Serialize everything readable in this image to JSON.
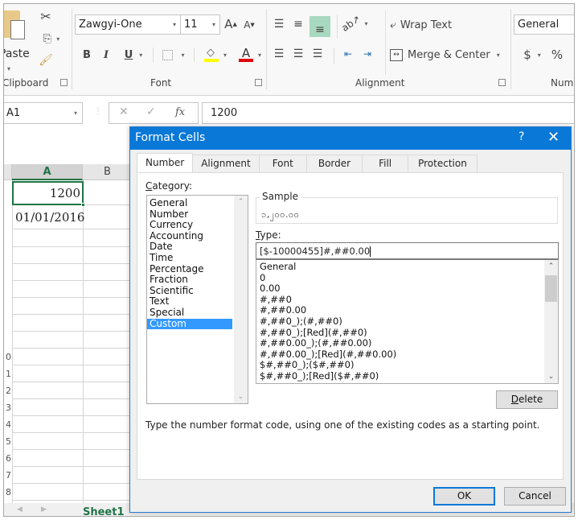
{
  "ribbon": {
    "clipboard": {
      "paste_label": "Paste",
      "group_label": "Clipboard",
      "icons": [
        "paste-icon",
        "cut-icon",
        "copy-icon",
        "format-painter-icon"
      ]
    },
    "font": {
      "font_name": "Zawgyi-One",
      "font_size": "11",
      "grow_label": "A",
      "shrink_label": "A",
      "bold_label": "B",
      "italic_label": "I",
      "underline_label": "U",
      "font_color_label": "A",
      "group_label": "Font",
      "highlight_color": "#ffff00",
      "font_color": "#e00000"
    },
    "alignment": {
      "wrap_text_label": "Wrap Text",
      "merge_center_label": "Merge & Center",
      "group_label": "Alignment",
      "active_color": "#a9d8c0"
    },
    "number": {
      "format_value": "General",
      "currency_label": "$",
      "percent_label": "%",
      "group_label": "Numl"
    }
  },
  "formula_bar": {
    "name_box": "A1",
    "cancel_glyph": "✕",
    "enter_glyph": "✓",
    "fx_label": "fx",
    "formula_value": "1200"
  },
  "grid": {
    "columns": [
      "A",
      "B"
    ],
    "cells": {
      "A1": "1200",
      "A2": "01/01/2016"
    },
    "row_numbers_partial": [
      "0",
      "1",
      "2",
      "3",
      "4",
      "5",
      "6",
      "7",
      "8"
    ],
    "sheet_tab": "Sheet1",
    "accent": "#217346"
  },
  "dialog": {
    "title": "Format Cells",
    "help_glyph": "?",
    "close_glyph": "✕",
    "tabs": [
      "Number",
      "Alignment",
      "Font",
      "Border",
      "Fill",
      "Protection"
    ],
    "active_tab": "Number",
    "category_label": "Category:",
    "categories": [
      "General",
      "Number",
      "Currency",
      "Accounting",
      "Date",
      "Time",
      "Percentage",
      "Fraction",
      "Scientific",
      "Text",
      "Special",
      "Custom"
    ],
    "selected_category": "Custom",
    "sample_label": "Sample",
    "sample_value": "၁,၂၀၀.၀၀",
    "type_label": "Type:",
    "type_value": "[$-10000455]#,##0.00",
    "type_list": [
      "General",
      "0",
      "0.00",
      "#,##0",
      "#,##0.00",
      "#,##0_);(#,##0)",
      "#,##0_);[Red](#,##0)",
      "#,##0.00_);(#,##0.00)",
      "#,##0.00_);[Red](#,##0.00)",
      "$#,##0_);($#,##0)",
      "$#,##0_);[Red]($#,##0)"
    ],
    "delete_label": "Delete",
    "description": "Type the number format code, using one of the existing codes as a starting point.",
    "ok_label": "OK",
    "cancel_label": "Cancel",
    "title_color": "#0a78d7",
    "selection_color": "#3399ff"
  }
}
